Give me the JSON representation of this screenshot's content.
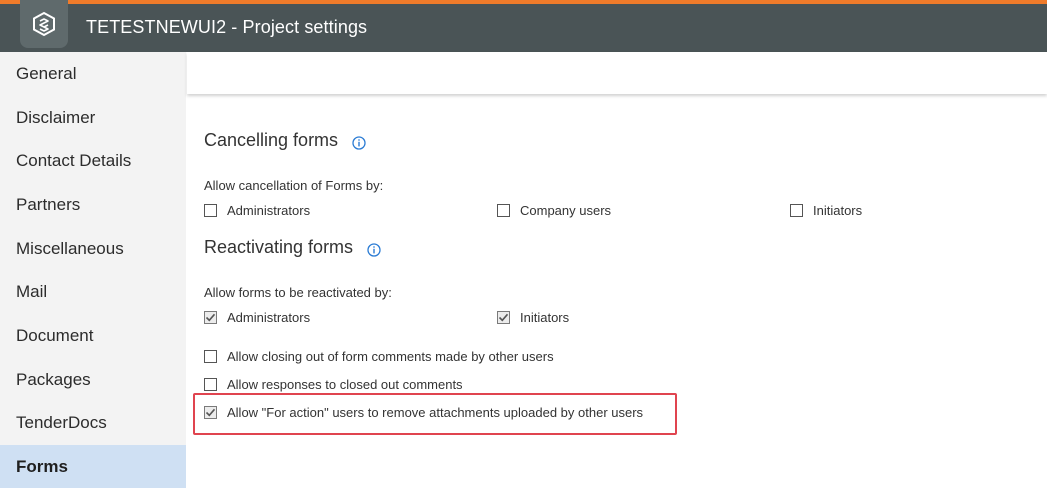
{
  "header": {
    "title": "TETESTNEWUI2 - Project settings",
    "logo_icon": "logo-icon",
    "accent_color": "#f07b2a"
  },
  "sidebar": {
    "items": [
      {
        "label": "General",
        "active": false
      },
      {
        "label": "Disclaimer",
        "active": false
      },
      {
        "label": "Contact Details",
        "active": false
      },
      {
        "label": "Partners",
        "active": false
      },
      {
        "label": "Miscellaneous",
        "active": false
      },
      {
        "label": "Mail",
        "active": false
      },
      {
        "label": "Document",
        "active": false
      },
      {
        "label": "Packages",
        "active": false
      },
      {
        "label": "TenderDocs",
        "active": false
      },
      {
        "label": "Forms",
        "active": true
      }
    ]
  },
  "cancelling": {
    "title": "Cancelling forms",
    "label": "Allow cancellation of Forms by:",
    "options": [
      {
        "label": "Administrators",
        "checked": false
      },
      {
        "label": "Company users",
        "checked": false
      },
      {
        "label": "Initiators",
        "checked": false
      }
    ]
  },
  "reactivating": {
    "title": "Reactivating forms",
    "label": "Allow forms to be reactivated by:",
    "options": [
      {
        "label": "Administrators",
        "checked": true
      },
      {
        "label": "Initiators",
        "checked": true
      }
    ]
  },
  "extra_options": [
    {
      "label": "Allow closing out of form comments made by other users",
      "checked": false
    },
    {
      "label": "Allow responses to closed out comments",
      "checked": false
    },
    {
      "label": "Allow \"For action\" users to remove attachments uploaded by other users",
      "checked": true
    }
  ],
  "highlight_color": "#e0444f"
}
